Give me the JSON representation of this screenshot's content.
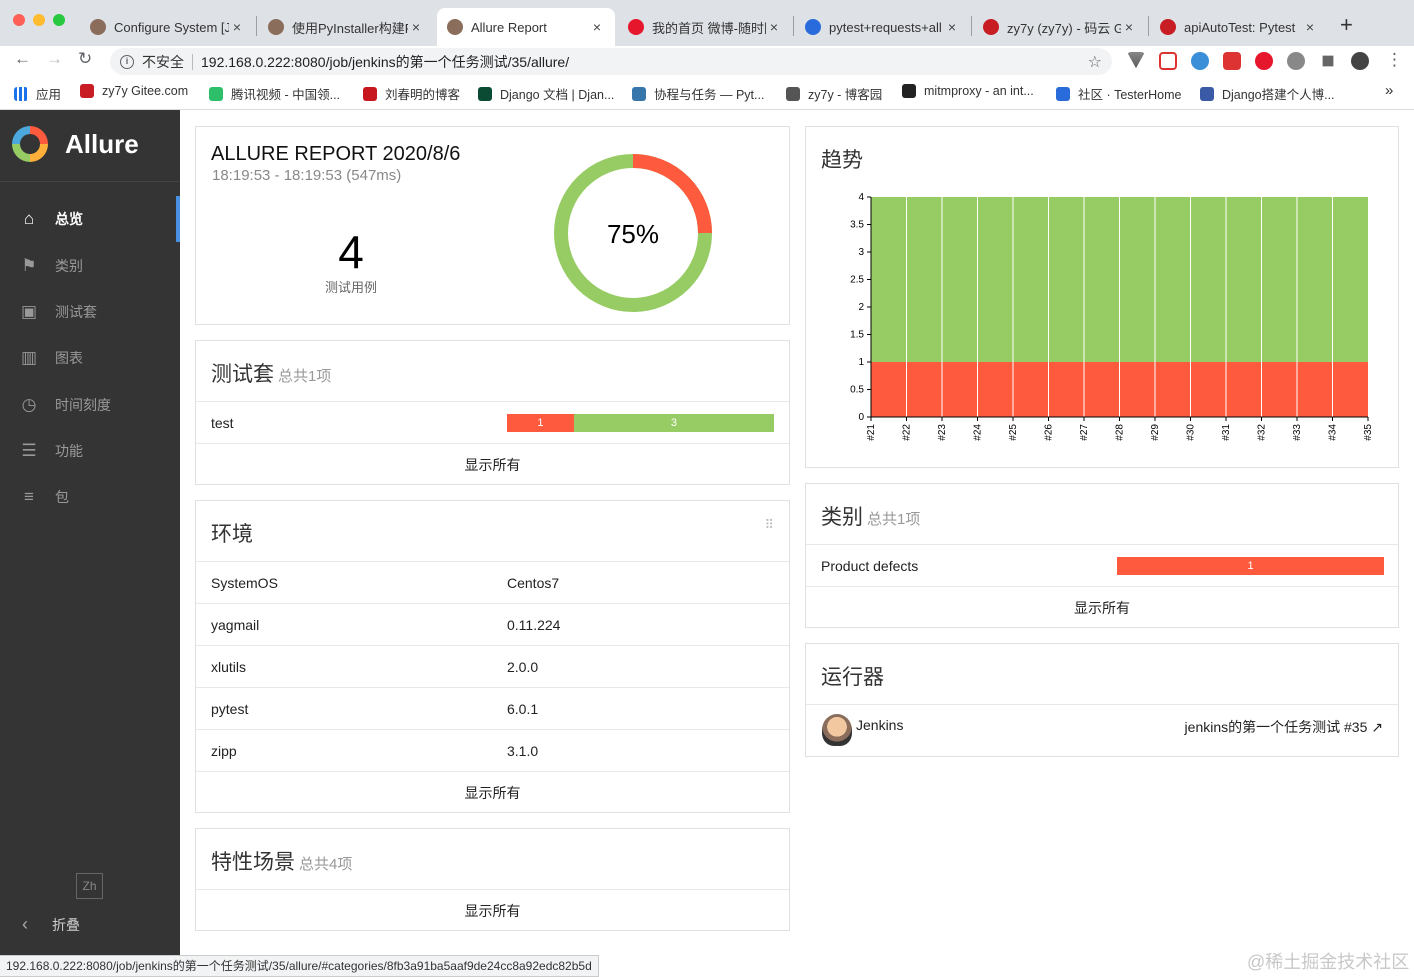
{
  "browser": {
    "tabs": [
      {
        "title": "Configure System [J",
        "color": "#8a6d5b"
      },
      {
        "title": "使用PyInstaller构建P",
        "color": "#8a6d5b"
      },
      {
        "title": "Allure Report",
        "color": "#8a6d5b",
        "active": true
      },
      {
        "title": "我的首页 微博-随时随",
        "color": "#e6162d"
      },
      {
        "title": "pytest+requests+all",
        "color": "#2a6bdc"
      },
      {
        "title": "zy7y (zy7y) - 码云 G",
        "color": "#c71d23"
      },
      {
        "title": "apiAutoTest: Pytest",
        "color": "#c71d23"
      }
    ],
    "new_tab": "+",
    "close_glyph": "×",
    "insecure_label": "不安全",
    "url": "192.168.0.222:8080/job/jenkins的第一个任务测试/35/allure/",
    "bookmarks": [
      {
        "label": "应用",
        "color": "#1a73e8"
      },
      {
        "label": "zy7y  Gitee.com",
        "color": "#c71d23"
      },
      {
        "label": "腾讯视频 - 中国领...",
        "color": "#2dbf69"
      },
      {
        "label": "刘春明的博客",
        "color": "#c7161d"
      },
      {
        "label": "Django 文档 | Djan...",
        "color": "#0c4b33"
      },
      {
        "label": "协程与任务 — Pyt...",
        "color": "#3776ab"
      },
      {
        "label": "zy7y - 博客园",
        "color": "#555555"
      },
      {
        "label": "mitmproxy - an int...",
        "color": "#222222"
      },
      {
        "label": "社区 · TesterHome",
        "color": "#2a6bdc"
      },
      {
        "label": "Django搭建个人博...",
        "color": "#3b5aa6"
      }
    ],
    "bookmarks_more": "»",
    "status_url": "192.168.0.222:8080/job/jenkins的第一个任务测试/35/allure/#categories/8fb3a91ba5aaf9de24cc8a92edc82b5d"
  },
  "sidebar": {
    "brand": "Allure",
    "items": [
      {
        "label": "总览",
        "icon": "home-icon",
        "glyph": "⌂",
        "active": true
      },
      {
        "label": "类别",
        "icon": "flag-icon",
        "glyph": "⚑"
      },
      {
        "label": "测试套",
        "icon": "briefcase-icon",
        "glyph": "▣"
      },
      {
        "label": "图表",
        "icon": "bar-chart-icon",
        "glyph": "▥"
      },
      {
        "label": "时间刻度",
        "icon": "clock-icon",
        "glyph": "◷"
      },
      {
        "label": "功能",
        "icon": "list-icon",
        "glyph": "☰"
      },
      {
        "label": "包",
        "icon": "align-left-icon",
        "glyph": "≡"
      }
    ],
    "lang": "Zh",
    "collapse_label": "折叠",
    "collapse_glyph": "‹"
  },
  "summary": {
    "title": "ALLURE REPORT 2020/8/6",
    "time": "18:19:53 - 18:19:53 (547ms)",
    "count": "4",
    "count_label": "测试用例",
    "percent": "75%",
    "failed_fraction": 0.25
  },
  "suites": {
    "title": "测试套",
    "subtitle": "总共1项",
    "rows": [
      {
        "name": "test",
        "failed": "1",
        "passed": "3",
        "failed_n": 1,
        "passed_n": 3
      }
    ],
    "show_all": "显示所有"
  },
  "environment": {
    "title": "环境",
    "rows": [
      {
        "key": "SystemOS",
        "value": "Centos7"
      },
      {
        "key": "yagmail",
        "value": "0.11.224"
      },
      {
        "key": "xlutils",
        "value": "2.0.0"
      },
      {
        "key": "pytest",
        "value": "6.0.1"
      },
      {
        "key": "zipp",
        "value": "3.1.0"
      }
    ],
    "show_all": "显示所有"
  },
  "features": {
    "title": "特性场景",
    "subtitle": "总共4项",
    "show_all": "显示所有"
  },
  "trend": {
    "title": "趋势"
  },
  "categories": {
    "title": "类别",
    "subtitle": "总共1项",
    "rows": [
      {
        "name": "Product defects",
        "count": "1"
      }
    ],
    "show_all": "显示所有"
  },
  "executors": {
    "title": "运行器",
    "name": "Jenkins",
    "build": "jenkins的第一个任务测试 #35",
    "link_glyph": "↗"
  },
  "watermark": "@稀土掘金技术社区",
  "colors": {
    "failed": "#fd5a3e",
    "passed": "#97cc64",
    "sidebar": "#343434",
    "accent": "#4a90e2"
  },
  "chart_data": {
    "type": "area",
    "title": "",
    "x": [
      "#21",
      "#22",
      "#23",
      "#24",
      "#25",
      "#26",
      "#27",
      "#28",
      "#29",
      "#30",
      "#31",
      "#32",
      "#33",
      "#34",
      "#35"
    ],
    "series": [
      {
        "values": [
          1,
          1,
          1,
          1,
          1,
          1,
          1,
          1,
          1,
          1,
          1,
          1,
          1,
          1,
          1
        ],
        "color": "#fd5a3e"
      },
      {
        "values": [
          3,
          3,
          3,
          3,
          3,
          3,
          3,
          3,
          3,
          3,
          3,
          3,
          3,
          3,
          3
        ],
        "color": "#97cc64"
      }
    ],
    "stacked": true,
    "ylim": [
      0,
      4
    ],
    "yticks": [
      "0",
      "0.5",
      "1",
      "1.5",
      "2",
      "2.5",
      "3",
      "3.5",
      "4"
    ]
  }
}
